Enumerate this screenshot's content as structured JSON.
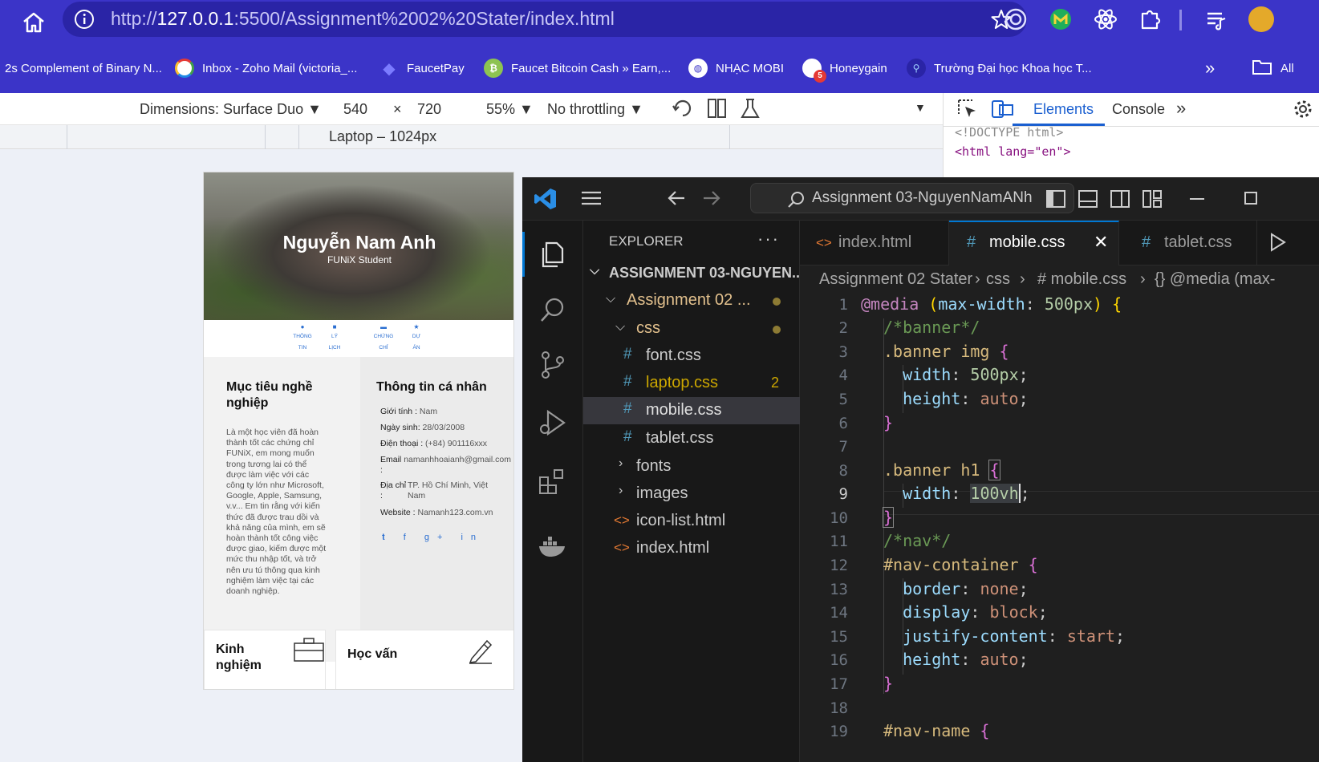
{
  "browser": {
    "url_scheme": "http://",
    "url_host": "127.0.0.1",
    "url_rest": ":5500/Assignment%2002%20Stater/index.html",
    "bookmarks": [
      {
        "label": "2s Complement of Binary N...",
        "icon": "none"
      },
      {
        "label": "Inbox - Zoho Mail (victoria_...",
        "icon": "zoho-icon"
      },
      {
        "label": "FaucetPay",
        "icon": "faucetpay-icon"
      },
      {
        "label": "Faucet Bitcoin Cash » Earn,...",
        "icon": "bitcoin-cash-icon"
      },
      {
        "label": "NHẠC MOBI",
        "icon": "globe-icon"
      },
      {
        "label": "Honeygain",
        "icon": "honeygain-icon",
        "badge": "5"
      },
      {
        "label": "Trường Đại học Khoa học T...",
        "icon": "university-icon"
      },
      {
        "label": "All",
        "icon": "folder-icon"
      }
    ],
    "more_label": "»"
  },
  "device_toolbar": {
    "dimensions_label": "Dimensions: Surface Duo",
    "width": "540",
    "times": "×",
    "height": "720",
    "zoom": "55%",
    "throttling": "No throttling",
    "media_label": "Laptop – 1024px"
  },
  "devtools": {
    "tabs": [
      "Elements",
      "Console"
    ],
    "more": "»",
    "lines": [
      "<!DOCTYPE html>",
      "<html lang=\"en\">"
    ]
  },
  "preview": {
    "name": "Nguyễn Nam Anh",
    "subtitle": "FUNiX Student",
    "nav": [
      {
        "icon": "user-icon",
        "line1": "THÔNG",
        "line2": "TIN"
      },
      {
        "icon": "document-icon",
        "line1": "LÝ",
        "line2": "LỊCH"
      },
      {
        "icon": "certificate-icon",
        "line1": "CHỨNG",
        "line2": "CHỈ"
      },
      {
        "icon": "star-icon",
        "line1": "DỰ",
        "line2": "ÁN"
      }
    ],
    "goal_title_1": "Mục tiêu nghề",
    "goal_title_2": "nghiệp",
    "goal_text": "Là một học viên đã hoàn thành tốt các chứng chỉ FUNiX, em mong muốn trong tương lai có thể được làm việc với các công ty lớn như Microsoft, Google, Apple, Samsung, v.v... Em tin rằng với kiến thức đã được trau dồi và khả năng của mình, em sẽ hoàn thành tốt công việc được giao, kiếm được một mức thu nhập tốt, và trở nên ưu tú thông qua kinh nghiệm làm việc tại các doanh nghiệp.",
    "info_title": "Thông tin cá nhân",
    "info": {
      "gender_label": "Giới tính :",
      "gender": "Nam",
      "dob_label": "Ngày sinh:",
      "dob": "28/03/2008",
      "phone_label": "Điện thoại :",
      "phone": "(+84) 901116xxx",
      "email_label": "Email",
      "email": "namanhhoaianh@gmail.com",
      "email_colon": ":",
      "address_label": "Địa chỉ",
      "address_colon": ":",
      "address_1": "TP. Hồ Chí Minh, Việt",
      "address_2": "Nam",
      "website_label": "Website :",
      "website": "Namanh123.com.vn"
    },
    "socials": "𝐭 f g+ in",
    "card1_title_1": "Kinh",
    "card1_title_2": "nghiệm",
    "card2_title": "Học vấn"
  },
  "vscode": {
    "search_text": "Assignment 03-NguyenNamANh",
    "explorer_label": "EXPLORER",
    "explorer_more": "···",
    "tree": [
      {
        "label": "ASSIGNMENT 03-NGUYEN...",
        "type": "root"
      },
      {
        "label": "Assignment 02 ...",
        "type": "folder-open",
        "modified": true
      },
      {
        "label": "css",
        "type": "folder-open",
        "modified": true
      },
      {
        "label": "font.css",
        "type": "css"
      },
      {
        "label": "laptop.css",
        "type": "css",
        "problems": "2"
      },
      {
        "label": "mobile.css",
        "type": "css",
        "selected": true
      },
      {
        "label": "tablet.css",
        "type": "css"
      },
      {
        "label": "fonts",
        "type": "folder"
      },
      {
        "label": "images",
        "type": "folder"
      },
      {
        "label": "icon-list.html",
        "type": "html"
      },
      {
        "label": "index.html",
        "type": "html"
      }
    ],
    "tabs": [
      {
        "label": "index.html",
        "icon": "html-icon"
      },
      {
        "label": "mobile.css",
        "icon": "css-hash-icon",
        "active": true
      },
      {
        "label": "tablet.css",
        "icon": "css-hash-icon"
      }
    ],
    "breadcrumb": [
      "Assignment 02 Stater",
      "css",
      "# mobile.css",
      "{} @media (max-"
    ],
    "current_line": 9
  }
}
